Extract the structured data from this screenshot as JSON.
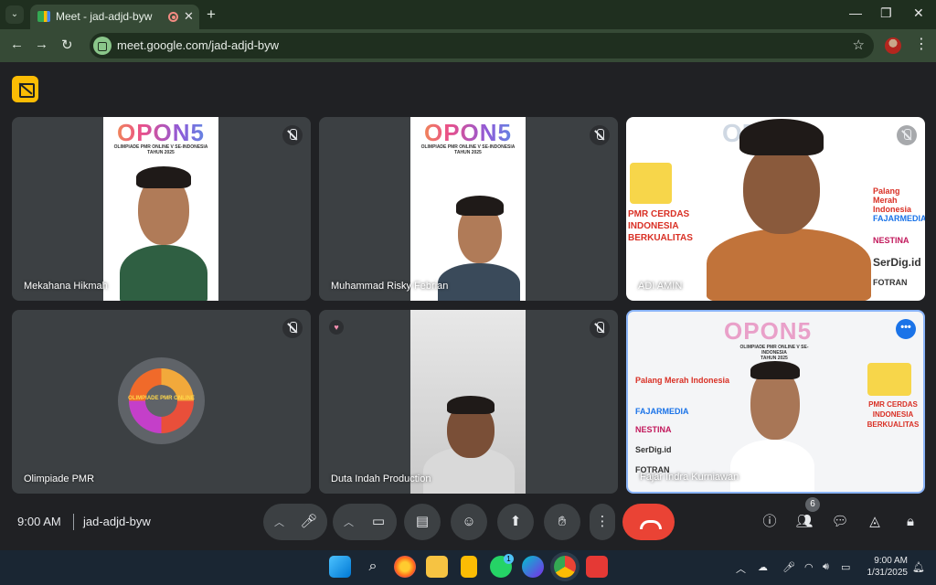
{
  "browser": {
    "tab_title": "Meet - jad-adjd-byw",
    "url": "meet.google.com/jad-adjd-byw"
  },
  "meet": {
    "participants": [
      {
        "name": "Mekahana Hikmah"
      },
      {
        "name": "Muhammad Risky Febrian"
      },
      {
        "name": "ADI AMIN"
      },
      {
        "name": "Olimpiade PMR"
      },
      {
        "name": "Duta Indah Production"
      },
      {
        "name": "Fajar Indra Kurniawan"
      }
    ],
    "poster_logo": "OPON5",
    "poster_subtitle_1": "OLIMPIADE PMR ONLINE V SE-INDONESIA",
    "poster_subtitle_2": "TAHUN 2025",
    "olimpiade_logo_text": "OLIMPIADE PMR ONLINE",
    "sponsors_right": [
      "Palang Merah Indonesia",
      "FAJARMEDIA",
      "NESTINA",
      "SerDig.id",
      "FOTRAN"
    ],
    "banner_right": [
      "PMR CERDAS",
      "INDONESIA",
      "BERKUALITAS"
    ],
    "time": "9:00 AM",
    "meeting_code": "jad-adjd-byw",
    "participant_count": "6"
  },
  "taskbar": {
    "time": "9:00 AM",
    "date": "1/31/2025",
    "whatsapp_badge": "1"
  },
  "colors": {
    "accent": "#8ab4f8",
    "end_call": "#ea4335",
    "badge": "#fbbc04"
  }
}
